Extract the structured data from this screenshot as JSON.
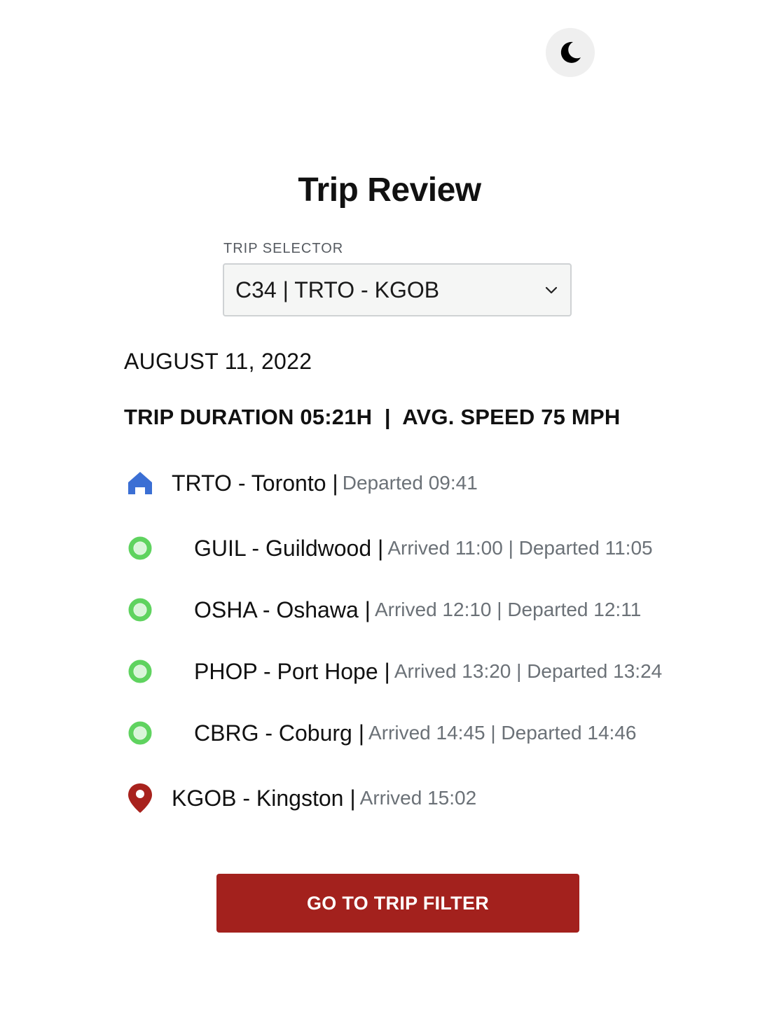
{
  "header": {
    "theme_toggle_icon": "moon-icon"
  },
  "page": {
    "title": "Trip Review"
  },
  "trip_selector": {
    "label": "TRIP SELECTOR",
    "value": "C34 | TRTO - KGOB",
    "icon": "chevron-down-icon"
  },
  "trip": {
    "date": "AUGUST 11, 2022",
    "summary": "TRIP DURATION 05:21H  |  AVG. SPEED 75 MPH"
  },
  "stops": [
    {
      "name": "TRTO - Toronto |",
      "times": "Departed 09:41",
      "icon": "home-icon"
    },
    {
      "name": "GUIL - Guildwood |",
      "times": "Arrived 11:00 | Departed 11:05",
      "icon": "stop-dot-icon"
    },
    {
      "name": "OSHA - Oshawa |",
      "times": "Arrived 12:10 | Departed 12:11",
      "icon": "stop-dot-icon"
    },
    {
      "name": "PHOP - Port Hope |",
      "times": "Arrived 13:20 | Departed 13:24",
      "icon": "stop-dot-icon"
    },
    {
      "name": "CBRG - Coburg |",
      "times": "Arrived 14:45 | Departed 14:46",
      "icon": "stop-dot-icon"
    },
    {
      "name": "KGOB - Kingston |",
      "times": "Arrived 15:02",
      "icon": "map-pin-icon"
    }
  ],
  "actions": {
    "go_to_filter": "GO TO TRIP FILTER"
  },
  "colors": {
    "accent": "#a3211d",
    "home": "#3b6fd4",
    "stop_dot": "#5fd35f",
    "destination_pin": "#a8221d",
    "muted_text": "#6b7177"
  }
}
